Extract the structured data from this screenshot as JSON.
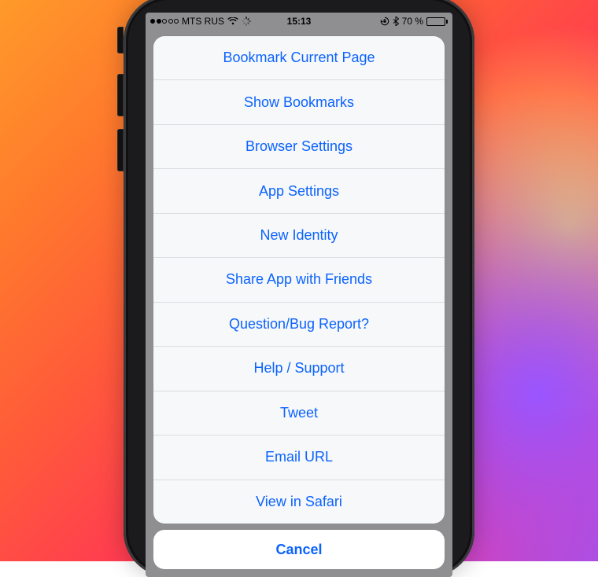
{
  "statusbar": {
    "carrier": "MTS RUS",
    "signal_filled": 2,
    "signal_total": 5,
    "time": "15:13",
    "battery_percent_label": "70 %",
    "battery_fill_pct": 70
  },
  "action_sheet": {
    "items": [
      "Bookmark Current Page",
      "Show Bookmarks",
      "Browser Settings",
      "App Settings",
      "New Identity",
      "Share App with Friends",
      "Question/Bug Report?",
      "Help / Support",
      "Tweet",
      "Email URL",
      "View in Safari"
    ],
    "cancel_label": "Cancel"
  }
}
